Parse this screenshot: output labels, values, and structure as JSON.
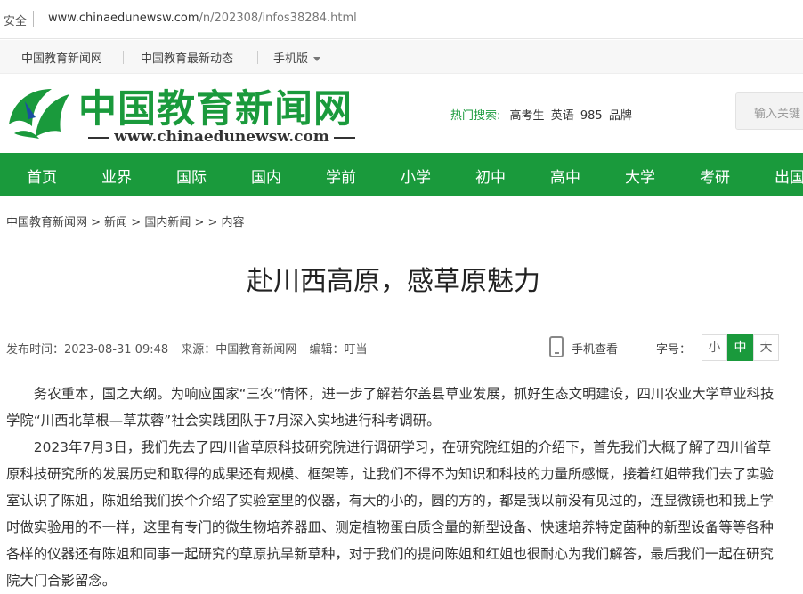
{
  "browser": {
    "security_label": "安全",
    "url_host": "www.chinaedunewsw.com",
    "url_path": "/n/202308/infos38284.html"
  },
  "toplinks": {
    "home": "中国教育新闻网",
    "latest": "中国教育最新动态",
    "mobile": "手机版"
  },
  "header": {
    "logo_cn": "中国教育新闻网",
    "logo_url": "www.chinaedunewsw.com",
    "hot_label": "热门搜索:",
    "hot_keywords": [
      "高考生",
      "英语",
      "985",
      "品牌"
    ],
    "search_placeholder": "输入关键"
  },
  "nav": [
    "首页",
    "业界",
    "国际",
    "国内",
    "学前",
    "小学",
    "初中",
    "高中",
    "大学",
    "考研",
    "出国"
  ],
  "breadcrumb": "中国教育新闻网 > 新闻 > 国内新闻 > > 内容",
  "article": {
    "title": "赴川西高原，感草原魅力",
    "publish_time": "发布时间：2023-08-31 09:48",
    "source": "来源：中国教育新闻网",
    "editor": "编辑：叮当",
    "mobile_view": "手机查看",
    "font_size_label": "字号：",
    "font_sizes": [
      "小",
      "中",
      "大"
    ],
    "paragraphs": [
      "务农重本，国之大纲。为响应国家“三农”情怀，进一步了解若尔盖县草业发展，抓好生态文明建设，四川农业大学草业科技学院“川西北草根—草苁蓉”社会实践团队于7月深入实地进行科考调研。",
      "2023年7月3日，我们先去了四川省草原科技研究院进行调研学习，在研究院红姐的介绍下，首先我们大概了解了四川省草原科技研究所的发展历史和取得的成果还有规模、框架等，让我们不得不为知识和科技的力量所感慨，接着红姐带我们去了实验室认识了陈姐，陈姐给我们挨个介绍了实验室里的仪器，有大的小的，圆的方的，都是我以前没有见过的，连显微镜也和我上学时做实验用的不一样，这里有专门的微生物培养器皿、测定植物蛋白质含量的新型设备、快速培养特定菌种的新型设备等等各种各样的仪器还有陈姐和同事一起研究的草原抗旱新草种，对于我们的提问陈姐和红姐也很耐心为我们解答，最后我们一起在研究院大门合影留念。"
    ]
  },
  "colors": {
    "brand_green": "#1a9a3c"
  }
}
